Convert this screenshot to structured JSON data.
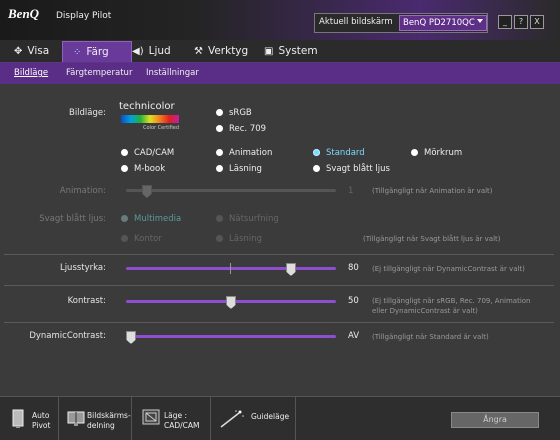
{
  "titlebar": {
    "brand": "BenQ",
    "app_name": "Display Pilot",
    "monitor_label": "Aktuell bildskärm",
    "monitor_value": "BenQ PD2710QC",
    "btn_min": "_",
    "btn_help": "?",
    "btn_close": "X"
  },
  "tabs": [
    {
      "label": "Visa",
      "icon": "move-arrows-icon"
    },
    {
      "label": "Färg",
      "icon": "color-dots-icon",
      "active": true
    },
    {
      "label": "Ljud",
      "icon": "speaker-icon"
    },
    {
      "label": "Verktyg",
      "icon": "wrench-icon"
    },
    {
      "label": "System",
      "icon": "window-system-icon"
    }
  ],
  "subtabs": [
    {
      "label": "Bildläge",
      "active": true
    },
    {
      "label": "Färgtemperatur"
    },
    {
      "label": "Inställningar"
    }
  ],
  "bildlage": {
    "label": "Bildläge:",
    "logo_word": "technicolor",
    "logo_sub": "Color Certified",
    "options": {
      "srgb": "sRGB",
      "rec709": "Rec. 709",
      "cadcam": "CAD/CAM",
      "animation": "Animation",
      "standard": "Standard",
      "morkrum": "Mörkrum",
      "mbook": "M-book",
      "lasning": "Läsning",
      "svagt": "Svagt blått ljus"
    },
    "selected": "Standard"
  },
  "animation": {
    "label": "Animation:",
    "value": "1",
    "hint": "(Tillgängligt när Animation är valt)"
  },
  "svagt_blatt": {
    "label": "Svagt blått ljus:",
    "options": {
      "multimedia": "Multimedia",
      "natsurfning": "Nätsurfning",
      "kontor": "Kontor",
      "lasning": "Läsning"
    },
    "hint": "(Tillgängligt när Svagt blått ljus är valt)"
  },
  "ljusstyrka": {
    "label": "Ljusstyrka:",
    "value": "80",
    "level": 0.8,
    "hint": "(Ej tillgängligt när DynamicContrast är valt)"
  },
  "kontrast": {
    "label": "Kontrast:",
    "value": "50",
    "level": 0.5,
    "hint1": "(Ej tillgängligt när sRGB, Rec. 709, Animation",
    "hint2": "eller DynamicContrast är valt)"
  },
  "dynamic": {
    "label": "DynamicContrast:",
    "value": "AV",
    "level": 0,
    "hint": "(Tillgängligt när Standard är valt)"
  },
  "bottom": {
    "auto_pivot_1": "Auto",
    "auto_pivot_2": "Pivot",
    "split_1": "Bildskärms-",
    "split_2": "delning",
    "mode_1": "Läge :",
    "mode_2": "CAD/CAM",
    "guide": "Guideläge",
    "undo": "Ångra"
  },
  "colors": {
    "accent": "#6a3a9a",
    "selected_radio": "#7fd8ff",
    "slider": "#8e4ed0"
  }
}
